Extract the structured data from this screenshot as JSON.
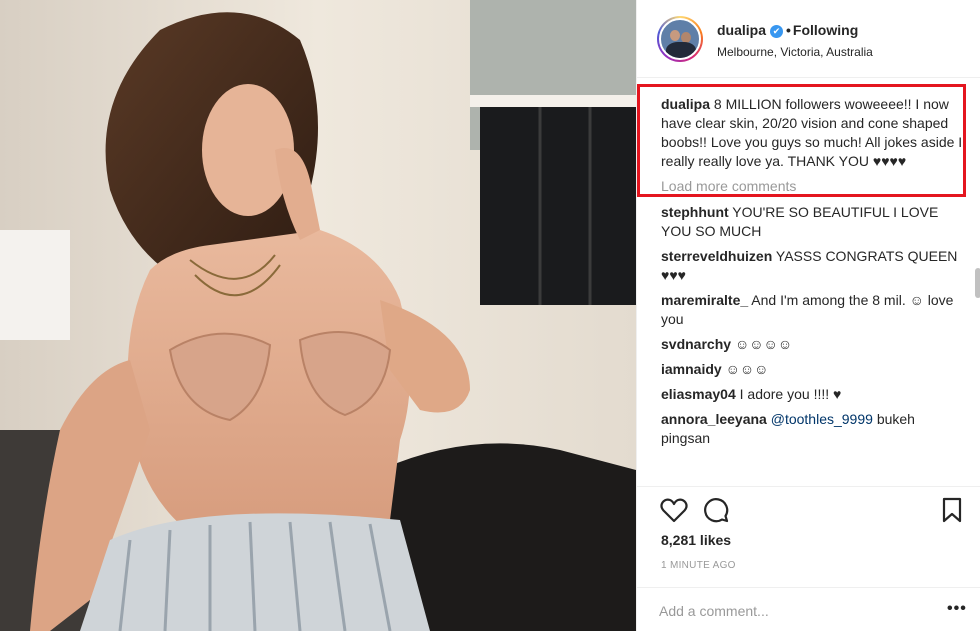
{
  "post": {
    "username": "dualipa",
    "verified_glyph": "✔",
    "separator": "•",
    "follow_status": "Following",
    "location": "Melbourne, Victoria, Australia",
    "photo_icon": "person-photo"
  },
  "caption": {
    "username": "dualipa",
    "text": "8 MILLION followers woweeee!! I now have clear skin, 20/20 vision and cone shaped boobs!! Love you guys so much! All jokes aside I really really love ya. THANK YOU ♥♥♥♥"
  },
  "load_more": "Load more comments",
  "comments": [
    {
      "username": "stephhunt",
      "text": "YOU'RE SO BEAUTIFUL I LOVE YOU SO MUCH"
    },
    {
      "username": "sterreveldhuizen",
      "text": "YASSS CONGRATS QUEEN ♥♥♥"
    },
    {
      "username": "maremiralte_",
      "text": "And I'm among the 8 mil. ☺ love you"
    },
    {
      "username": "svdnarchy",
      "text": "☺☺☺☺"
    },
    {
      "username": "iamnaidy",
      "text": "☺☺☺"
    },
    {
      "username": "eliasmay04",
      "text": "I adore you !!!! ♥"
    },
    {
      "username": "annora_leeyana",
      "mention": "@toothles_9999",
      "text": "bukeh pingsan"
    }
  ],
  "actions": {
    "like_icon": "heart-icon",
    "comment_icon": "comment-icon",
    "save_icon": "bookmark-icon"
  },
  "likes": "8,281 likes",
  "timestamp": "1 MINUTE AGO",
  "add_comment": {
    "placeholder": "Add a comment...",
    "more_label": "•••"
  },
  "colors": {
    "highlight_border": "#e4151f",
    "verified_blue": "#3897f0",
    "muted_text": "#999999",
    "mention_link": "#003569"
  }
}
